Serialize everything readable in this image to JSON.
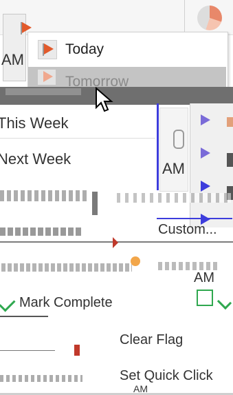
{
  "toolbar": {
    "time_fragment": "AM"
  },
  "flag_menu": {
    "items": [
      {
        "label": "Today"
      },
      {
        "label": "Tomorrow"
      },
      {
        "label": "This Week"
      },
      {
        "label": "Next Week"
      }
    ]
  },
  "side": {
    "time_fragment": "AM",
    "time_fragment_2": "AM"
  },
  "main_menu": {
    "custom_label": "Custom...",
    "mark_complete_label": "Mark Complete",
    "clear_flag_label": "Clear Flag",
    "set_quick_click_label": "Set Quick Click",
    "bottom_fragment": "AM"
  },
  "colors": {
    "flag": "#e25a2b",
    "hover": "#c4c4c4",
    "dark_band": "#6f6f6f",
    "accent_blue": "#3d3ddc",
    "green": "#2fa84f"
  }
}
